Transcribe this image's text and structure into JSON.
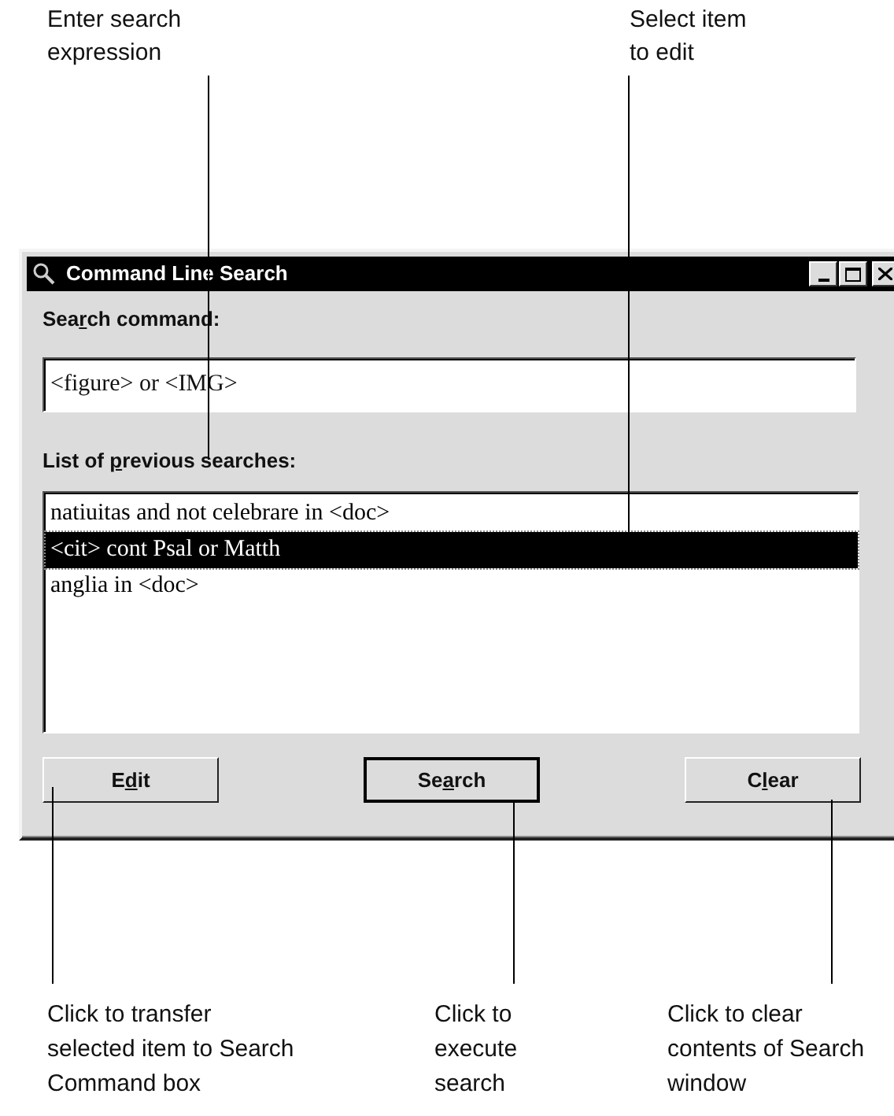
{
  "callouts_top": [
    {
      "text": "Enter search expression"
    },
    {
      "text": "Select item to edit"
    }
  ],
  "window": {
    "title": "Command Line Search",
    "search_label": {
      "before": "Sea",
      "key": "r",
      "after": "ch command:"
    },
    "search_field": {
      "value": "<figure> or <IMG>"
    },
    "list_label": {
      "before": "List of ",
      "key": "p",
      "after": "revious searches:"
    },
    "list_items": [
      {
        "text": "natiuitas and not celebrare in <doc>",
        "selected": false
      },
      {
        "text": "<cit> cont Psal or Matth",
        "selected": true
      },
      {
        "text": "anglia in <doc>",
        "selected": false
      }
    ],
    "buttons": [
      {
        "before": "E",
        "key": "d",
        "after": "it",
        "default": false
      },
      {
        "before": "Se",
        "key": "a",
        "after": "rch",
        "default": true
      },
      {
        "before": "C",
        "key": "l",
        "after": "ear",
        "default": false
      }
    ]
  },
  "callouts_bottom": [
    {
      "text": "Click to transfer selected item to Search Command box"
    },
    {
      "text": "Click to execute search"
    },
    {
      "text": "Click to clear contents of Search window"
    }
  ]
}
